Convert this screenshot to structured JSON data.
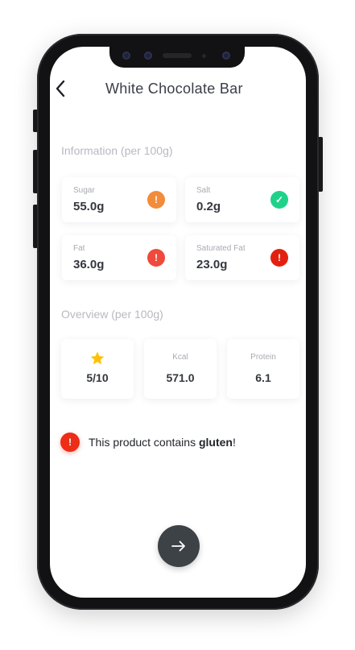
{
  "header": {
    "title": "White Chocolate Bar",
    "back_icon": "chevron-left-icon"
  },
  "information": {
    "label": "Information (per 100g)",
    "items": [
      {
        "name": "Sugar",
        "value": "55.0g",
        "status": "warning",
        "status_icon": "exclamation-icon",
        "color": "#f28c3a",
        "glyph": "!"
      },
      {
        "name": "Salt",
        "value": "0.2g",
        "status": "ok",
        "status_icon": "check-icon",
        "color": "#1fd28a",
        "glyph": "✓"
      },
      {
        "name": "Fat",
        "value": "36.0g",
        "status": "warning",
        "status_icon": "exclamation-icon",
        "color": "#ef4a3c",
        "glyph": "!"
      },
      {
        "name": "Saturated Fat",
        "value": "23.0g",
        "status": "danger",
        "status_icon": "exclamation-icon",
        "color": "#e3200f",
        "glyph": "!"
      }
    ]
  },
  "overview": {
    "label": "Overview (per 100g)",
    "rating": {
      "icon": "star-icon",
      "value": "5/10",
      "color": "#ffc107"
    },
    "kcal": {
      "label": "Kcal",
      "value": "571.0"
    },
    "protein": {
      "label": "Protein",
      "value": "6.1"
    }
  },
  "allergen": {
    "icon": "exclamation-icon",
    "text_prefix": "This product contains ",
    "allergen": "gluten",
    "text_suffix": "!",
    "color": "#ec2d17"
  },
  "next_button": {
    "icon": "arrow-right-icon"
  }
}
